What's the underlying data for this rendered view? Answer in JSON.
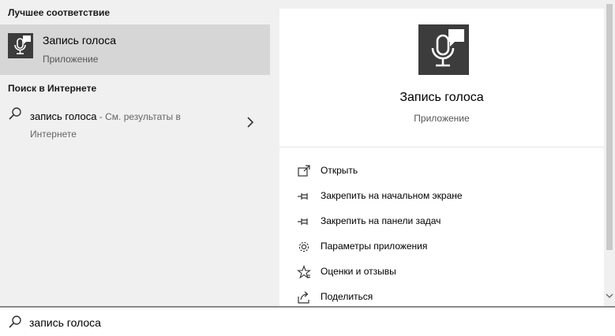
{
  "left": {
    "best_match_header": "Лучшее соответствие",
    "best_match": {
      "title": "Запись голоса",
      "subtitle": "Приложение",
      "icon": "voice-recorder-app-icon"
    },
    "web_header": "Поиск в Интернете",
    "web_item": {
      "query": "запись голоса",
      "hint": " - См. результаты в Интернете",
      "icon": "search-icon"
    }
  },
  "preview": {
    "title": "Запись голоса",
    "subtitle": "Приложение",
    "actions": [
      {
        "label": "Открыть",
        "icon": "open-icon"
      },
      {
        "label": "Закрепить на начальном экране",
        "icon": "pin-icon"
      },
      {
        "label": "Закрепить на панели задач",
        "icon": "pin-icon"
      },
      {
        "label": "Параметры приложения",
        "icon": "gear-icon"
      },
      {
        "label": "Оценки и отзывы",
        "icon": "star-icon"
      },
      {
        "label": "Поделиться",
        "icon": "share-icon"
      }
    ]
  },
  "search": {
    "value": "запись голоса"
  },
  "colors": {
    "app_tile": "#3c3c3c",
    "selected_bg": "#d6d6d6",
    "panel_bg": "#f0f0f0"
  }
}
